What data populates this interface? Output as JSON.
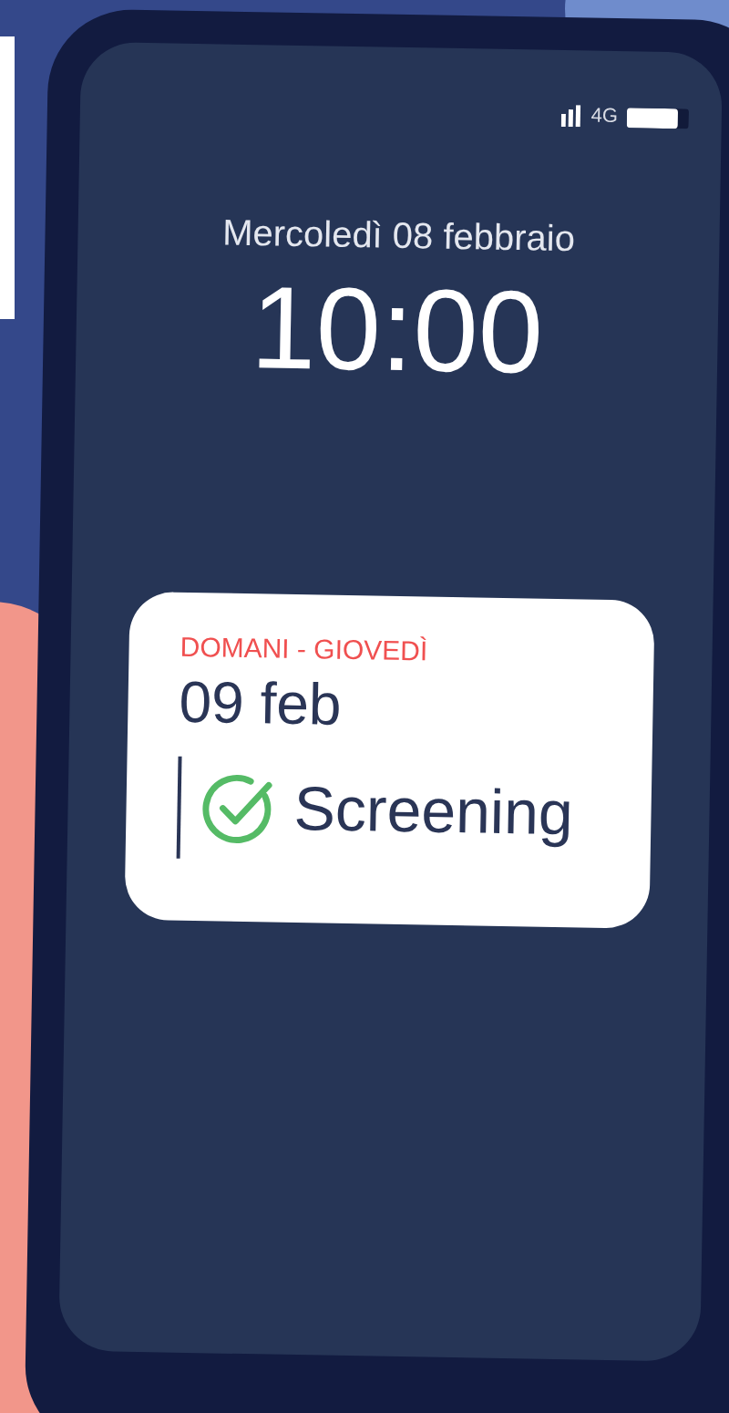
{
  "status_bar": {
    "network": "4G"
  },
  "lock_screen": {
    "date": "Mercoledì 08 febbraio",
    "time": "10:00"
  },
  "notification": {
    "label": "DOMANI - GIOVEDÌ",
    "date": "09 feb",
    "event": "Screening",
    "done": true
  }
}
